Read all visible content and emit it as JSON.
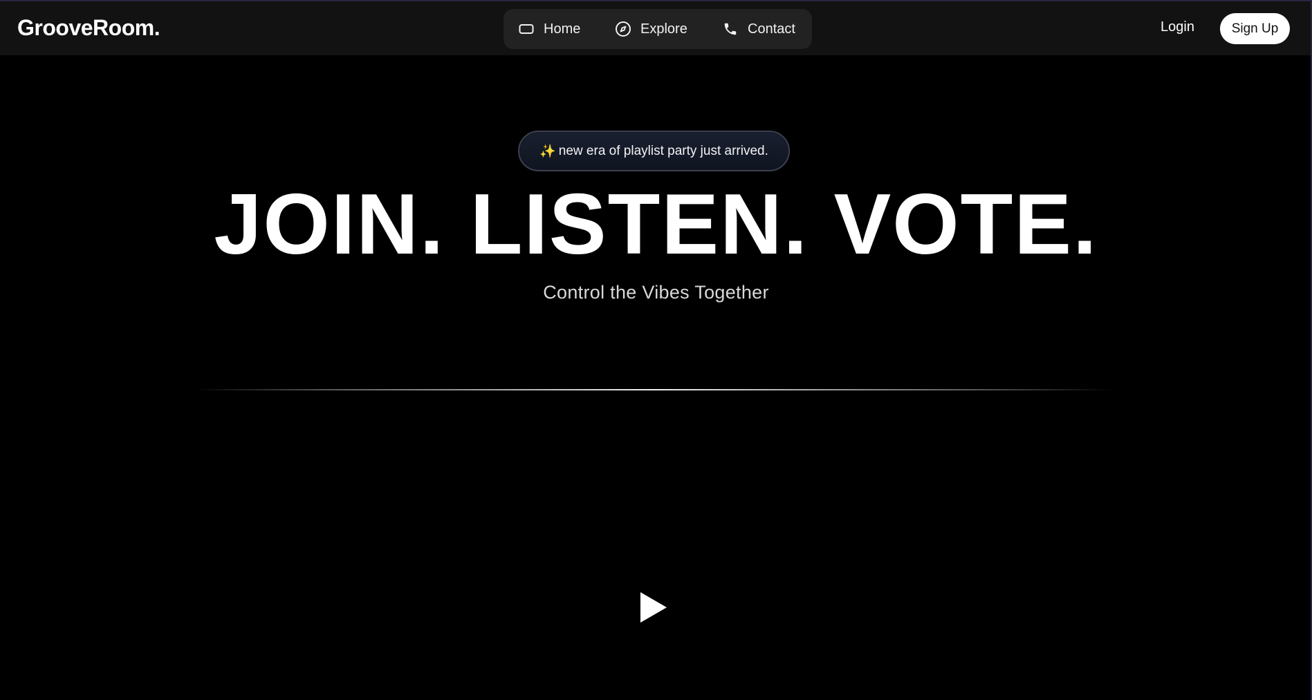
{
  "brand": {
    "name": "GrooveRoom."
  },
  "nav": {
    "items": [
      {
        "label": "Home",
        "icon": "home-icon"
      },
      {
        "label": "Explore",
        "icon": "compass-icon"
      },
      {
        "label": "Contact",
        "icon": "phone-icon"
      }
    ]
  },
  "auth": {
    "login_label": "Login",
    "signup_label": "Sign Up"
  },
  "hero": {
    "badge_icon": "✨",
    "badge_text": "new era of playlist party just arrived.",
    "headline": "JOIN. LISTEN. VOTE.",
    "subheadline": "Control the Vibes Together"
  },
  "media": {
    "play_icon": "play-icon"
  },
  "colors": {
    "background": "#000000",
    "header": "#121212",
    "nav_pill": "#222222",
    "badge_bg": "#141a27",
    "accent_edge": "#2b2640"
  }
}
